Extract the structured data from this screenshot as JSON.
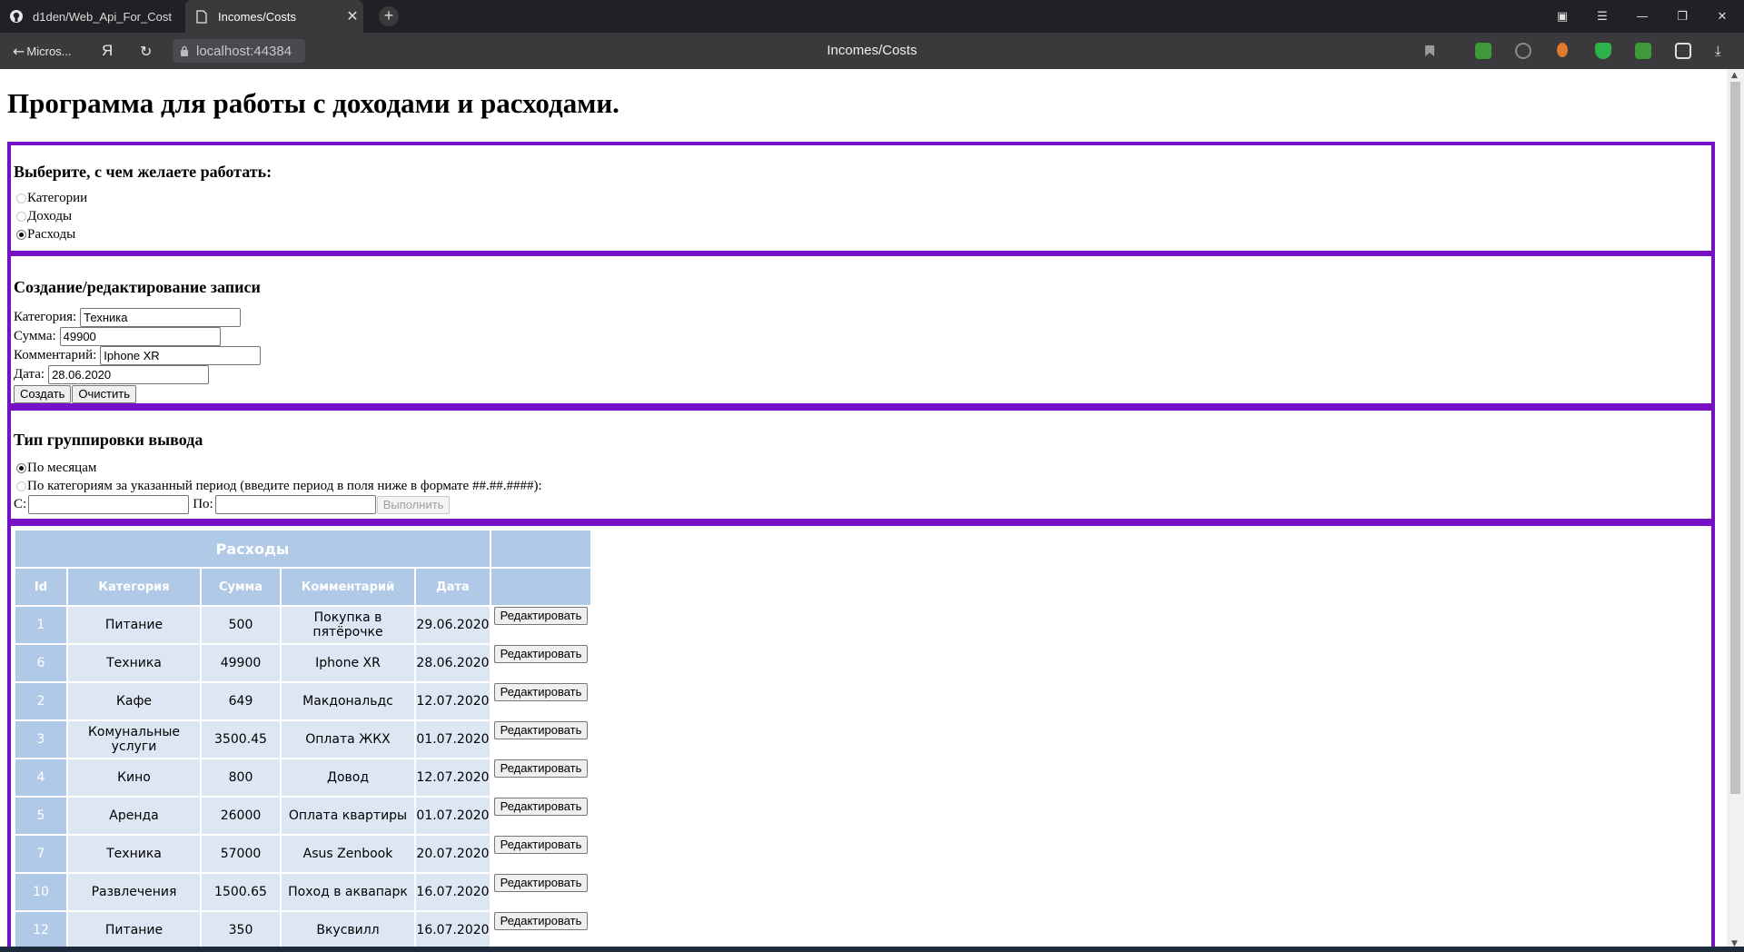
{
  "browser": {
    "tabs": [
      {
        "label": "d1den/Web_Api_For_Cost",
        "icon": "github-icon",
        "active": false
      },
      {
        "label": "Incomes/Costs",
        "icon": "page-icon",
        "active": true
      }
    ],
    "back_label": "Micros...",
    "yandex_glyph": "Я",
    "url": "localhost:44384",
    "page_title": "Incomes/Costs"
  },
  "page": {
    "heading": "Программа для работы с доходами и расходами.",
    "mode": {
      "heading": "Выберите, с чем желаете работать:",
      "options": [
        {
          "label": "Категории",
          "checked": false
        },
        {
          "label": "Доходы",
          "checked": false
        },
        {
          "label": "Расходы",
          "checked": true
        }
      ]
    },
    "editor": {
      "heading": "Создание/редактирование записи",
      "category_label": "Категория:",
      "category_value": "Техника",
      "sum_label": "Сумма:",
      "sum_value": "49900",
      "comment_label": "Комментарий:",
      "comment_value": "Iphone XR",
      "date_label": "Дата:",
      "date_value": "28.06.2020",
      "create_label": "Создать",
      "clear_label": "Очистить"
    },
    "grouping": {
      "heading": "Тип группировки вывода",
      "option_month": "По месяцам",
      "option_period": "По категориям за указанный период (введите период в поля ниже в формате ##.##.####):",
      "from_label": "С:",
      "to_label": "По:",
      "run_label": "Выполнить"
    },
    "table": {
      "caption": "Расходы",
      "headers": [
        "Id",
        "Категория",
        "Сумма",
        "Комментарий",
        "Дата",
        ""
      ],
      "edit_label": "Редактировать",
      "rows": [
        {
          "id": "1",
          "category": "Питание",
          "sum": "500",
          "comment": "Покупка в пятёрочке",
          "date": "29.06.2020"
        },
        {
          "id": "6",
          "category": "Техника",
          "sum": "49900",
          "comment": "Iphone XR",
          "date": "28.06.2020"
        },
        {
          "id": "2",
          "category": "Кафе",
          "sum": "649",
          "comment": "Макдональдс",
          "date": "12.07.2020"
        },
        {
          "id": "3",
          "category": "Комунальные услуги",
          "sum": "3500.45",
          "comment": "Оплата ЖКХ",
          "date": "01.07.2020"
        },
        {
          "id": "4",
          "category": "Кино",
          "sum": "800",
          "comment": "Довод",
          "date": "12.07.2020"
        },
        {
          "id": "5",
          "category": "Аренда",
          "sum": "26000",
          "comment": "Оплата квартиры",
          "date": "01.07.2020"
        },
        {
          "id": "7",
          "category": "Техника",
          "sum": "57000",
          "comment": "Asus Zenbook",
          "date": "20.07.2020"
        },
        {
          "id": "10",
          "category": "Развлечения",
          "sum": "1500.65",
          "comment": "Поход в аквапарк",
          "date": "16.07.2020"
        },
        {
          "id": "12",
          "category": "Питание",
          "sum": "350",
          "comment": "Вкусвилл",
          "date": "16.07.2020"
        }
      ]
    }
  },
  "colors": {
    "section_border": "#7711c5",
    "table_header": "#b0c9e6",
    "table_cell": "#dde7f4"
  }
}
